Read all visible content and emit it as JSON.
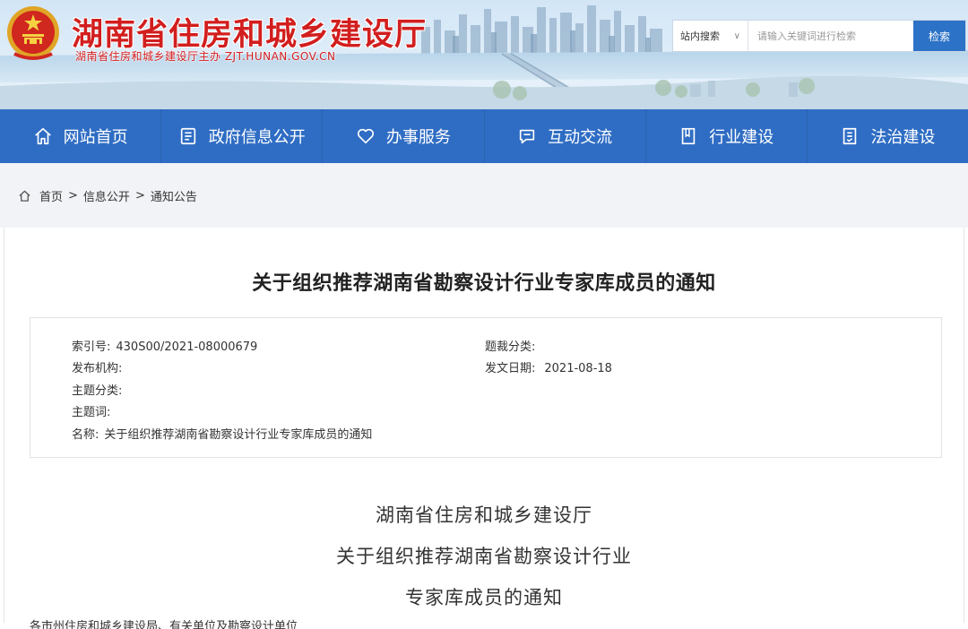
{
  "header": {
    "site_title": "湖南省住房和城乡建设厅",
    "site_subtitle": "湖南省住房和城乡建设厅主办  ZJT.HUNAN.GOV.CN",
    "emblem_icon": "national-emblem-icon"
  },
  "search": {
    "scope_label": "站内搜索",
    "placeholder": "请输入关键词进行检索",
    "button_label": "检索"
  },
  "nav": {
    "items": [
      {
        "label": "网站首页",
        "icon": "home-icon"
      },
      {
        "label": "政府信息公开",
        "icon": "document-icon"
      },
      {
        "label": "办事服务",
        "icon": "heart-icon"
      },
      {
        "label": "互动交流",
        "icon": "chat-icon"
      },
      {
        "label": "行业建设",
        "icon": "book-icon"
      },
      {
        "label": "法治建设",
        "icon": "law-document-icon"
      }
    ]
  },
  "breadcrumb": {
    "items": [
      "首页",
      "信息公开",
      "通知公告"
    ],
    "separator": ">"
  },
  "article": {
    "title": "关于组织推荐湖南省勘察设计行业专家库成员的通知",
    "meta": {
      "index_label": "索引号:",
      "index_value": "430S00/2021-08000679",
      "publisher_label": "发布机构:",
      "publisher_value": "",
      "topic_label": "主题分类:",
      "topic_value": "",
      "keywords_label": "主题词:",
      "keywords_value": "",
      "name_label": "名称:",
      "name_value": "关于组织推荐湖南省勘察设计行业专家库成员的通知",
      "genre_label": "题裁分类:",
      "genre_value": "",
      "date_label": "发文日期:",
      "date_value": "2021-08-18"
    },
    "body_heading": [
      "湖南省住房和城乡建设厅",
      "关于组织推荐湖南省勘察设计行业",
      "专家库成员的通知"
    ],
    "body_first_line": "各市州住房和城乡建设局、有关单位及勘察设计单位"
  },
  "colors": {
    "title_red": "#d21e1e",
    "nav_blue": "#2f6dc4",
    "search_button_blue": "#2c72c7",
    "breadcrumb_bg": "#f1f3f6"
  }
}
